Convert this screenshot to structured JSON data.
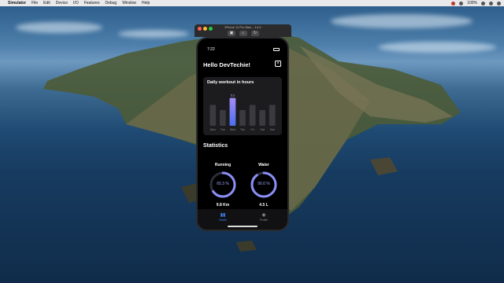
{
  "menubar": {
    "app": "Simulator",
    "items": [
      "File",
      "Edit",
      "Device",
      "I/O",
      "Features",
      "Debug",
      "Window",
      "Help"
    ],
    "battery": "100%"
  },
  "window": {
    "title": "iPhone 11 Pro Max – 14.0",
    "toolbar": [
      "screenshot-icon",
      "home-icon",
      "rotate-icon"
    ]
  },
  "phone": {
    "status_time": "7:22",
    "greeting": "Hello DevTechie!",
    "chart_card_title": "Daily workout in hours",
    "statistics_title": "Statistics",
    "stats": [
      {
        "label": "Running",
        "percent_text": "65.3 %",
        "fraction": 0.653,
        "value": "9.8 Km"
      },
      {
        "label": "Water",
        "percent_text": "90.0 %",
        "fraction": 0.9,
        "value": "4.5 L"
      }
    ],
    "tabs": [
      {
        "label": "Health",
        "active": true
      },
      {
        "label": "Profile",
        "active": false
      }
    ]
  },
  "chart_data": {
    "type": "bar",
    "title": "Daily workout in hours",
    "categories": [
      "Mon",
      "Tue",
      "Wed",
      "Thu",
      "Fri",
      "Sat",
      "Sun"
    ],
    "values": [
      4,
      3,
      5.3,
      3,
      4,
      3,
      4
    ],
    "highlight_index": 2,
    "highlight_label": "5.3",
    "ylim": [
      0,
      6
    ]
  },
  "colors": {
    "accent": "#3b82f6",
    "bar": "#3a3a3f",
    "bar_highlight_top": "#a58cf5",
    "bar_highlight_bottom": "#4b6ef0",
    "ring": "#8b8ff7"
  }
}
